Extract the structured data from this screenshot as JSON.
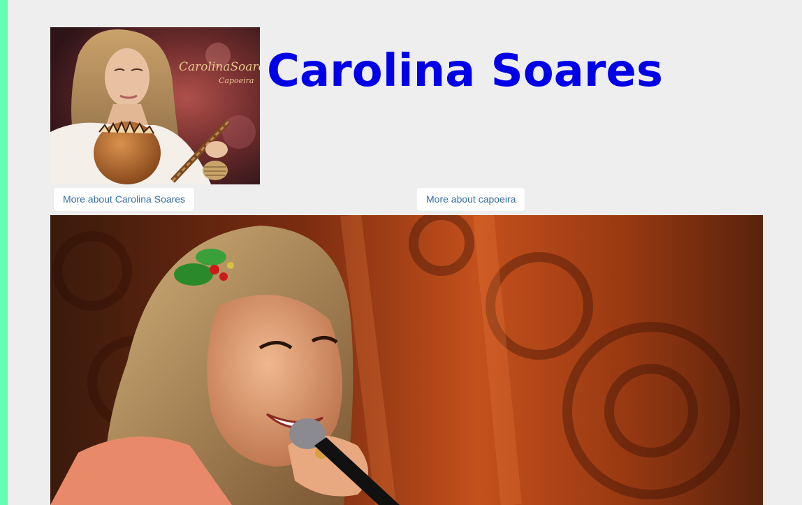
{
  "header": {
    "title": "Carolina Soares",
    "album_cover_text": {
      "name": "CarolinaSoares",
      "subtitle": "Capoeira"
    }
  },
  "links": {
    "about_artist": "More about Carolina Soares",
    "about_capoeira": "More about capoeira"
  },
  "colors": {
    "accent_bar": "#63ffb5",
    "title": "#0000e8",
    "link_text": "#336fa8",
    "background": "#eeeeee"
  }
}
